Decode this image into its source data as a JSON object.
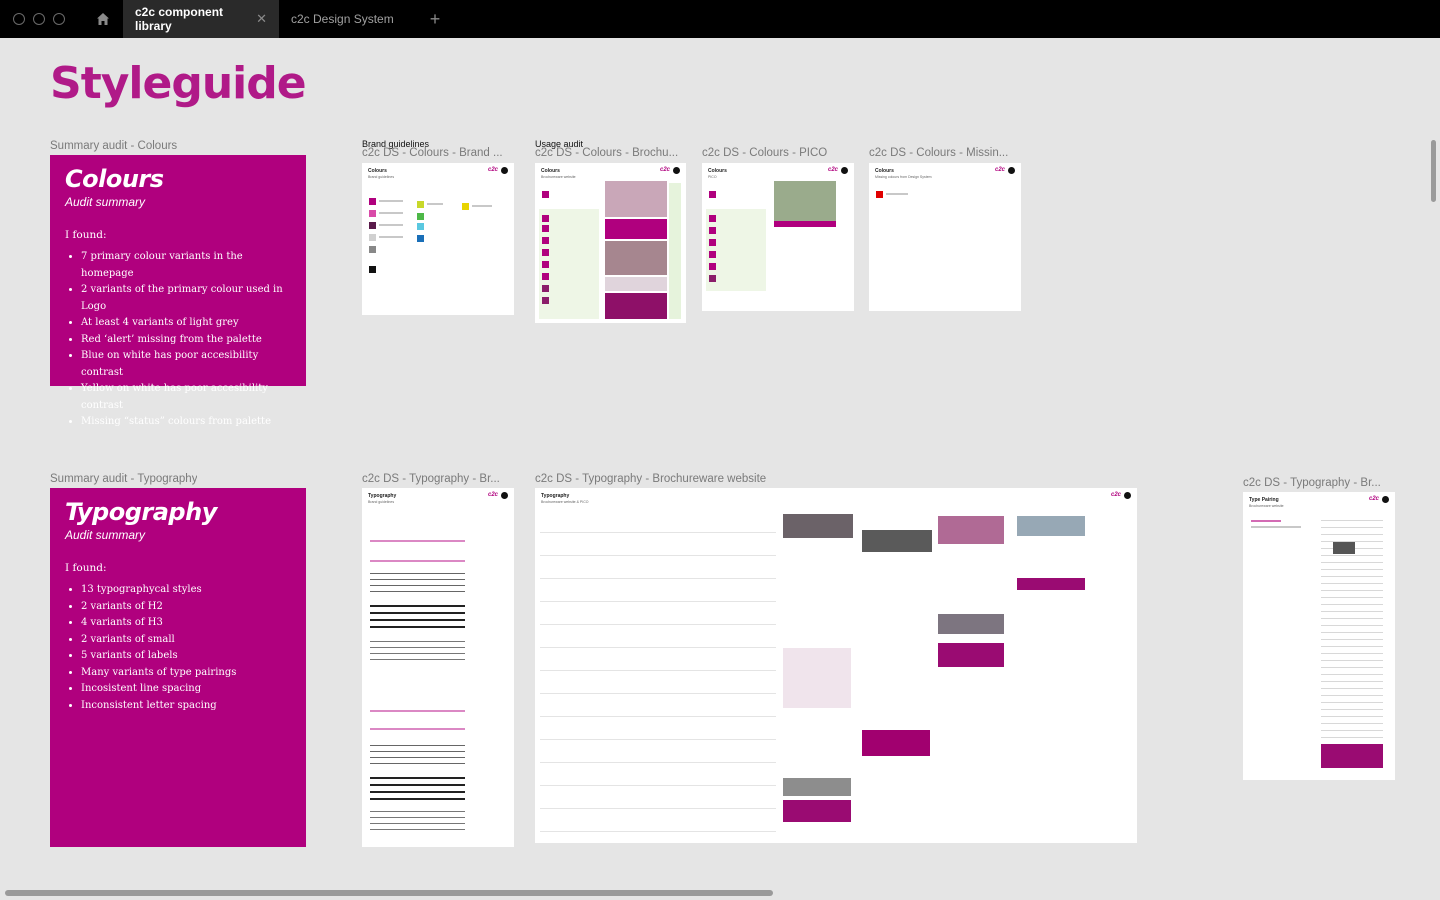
{
  "titlebar": {
    "tabs": [
      {
        "label": "c2c component library",
        "active": true
      },
      {
        "label": "c2c Design System",
        "active": false
      }
    ]
  },
  "canvas": {
    "title": "Styleguide",
    "colours_section": {
      "summary_label": "Summary audit - Colours",
      "card": {
        "heading": "Colours",
        "subheading": "Audit summary",
        "intro": "I found:",
        "findings": [
          "7 primary colour variants in the homepage",
          "2 variants of the primary colour used in Logo",
          "At least 4 variants of light grey",
          "Red ‘alert’ missing from the palette",
          "Blue on white has poor accesibility contrast",
          "Yellow on white has poor accesibility contrast",
          "Missing “status” colours from palette"
        ]
      },
      "frames": [
        {
          "group": "Brand guidelines",
          "label": "c2c DS - Colours - Brand ...",
          "header": "Colours",
          "sub": "Brand guidelines"
        },
        {
          "group": "Usage audit",
          "label": "c2c DS - Colours - Brochu...",
          "header": "Colours",
          "sub": "Brochureware website"
        },
        {
          "group": "",
          "label": "c2c DS - Colours - PICO",
          "header": "Colours",
          "sub": "PICO"
        },
        {
          "group": "",
          "label": "c2c DS - Colours - Missin...",
          "header": "Colours",
          "sub": "Missing colours from Design System"
        }
      ]
    },
    "typography_section": {
      "summary_label": "Summary audit - Typography",
      "card": {
        "heading": "Typography",
        "subheading": "Audit summary",
        "intro": "I found:",
        "findings": [
          "13 typographycal styles",
          "2 variants of H2",
          "4 variants of H3",
          "2 variants of small",
          "5 variants of labels",
          "Many variants of type pairings",
          "Incosistent line spacing",
          "Inconsistent letter spacing"
        ]
      },
      "frames": [
        {
          "label": "c2c DS - Typography - Br...",
          "header": "Typography",
          "sub": "Brand guidelines"
        },
        {
          "label": "c2c DS - Typography - Brochureware website",
          "header": "Typography",
          "sub": "Brochureware website & PICO"
        },
        {
          "label": "c2c DS - Typography - Br...",
          "header": "Type Pairing",
          "sub": "Brochureware website"
        }
      ]
    }
  },
  "brand": {
    "logo_text": "c2c"
  },
  "colors": {
    "accent": "#b0007e",
    "titlebar": "#000000",
    "canvas": "#e5e5e5"
  }
}
